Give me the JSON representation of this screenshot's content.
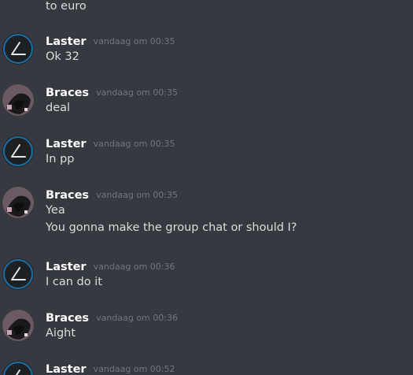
{
  "chat": {
    "continued_text": "to euro",
    "groups": [
      {
        "author": "Laster",
        "timestamp": "vandaag om 00:35",
        "avatar": "laster-logo-icon",
        "messages": [
          "Ok 32"
        ]
      },
      {
        "author": "Braces",
        "timestamp": "vandaag om 00:35",
        "avatar": "braces-avatar-image",
        "messages": [
          "deal"
        ]
      },
      {
        "author": "Laster",
        "timestamp": "vandaag om 00:35",
        "avatar": "laster-logo-icon",
        "messages": [
          "In pp"
        ]
      },
      {
        "author": "Braces",
        "timestamp": "vandaag om 00:35",
        "avatar": "braces-avatar-image",
        "messages": [
          "Yea",
          "You gonna make the group chat or should I?"
        ]
      },
      {
        "author": "Laster",
        "timestamp": "vandaag om 00:36",
        "avatar": "laster-logo-icon",
        "messages": [
          "I can do it"
        ]
      },
      {
        "author": "Braces",
        "timestamp": "vandaag om 00:36",
        "avatar": "braces-avatar-image",
        "messages": [
          "Aight"
        ]
      },
      {
        "author": "Laster",
        "timestamp": "vandaag om 00:52",
        "avatar": "laster-logo-icon",
        "messages": []
      }
    ]
  },
  "colors": {
    "background": "#36393f",
    "username": "#ffffff",
    "message_text": "#dcddde",
    "timestamp": "#72767d",
    "laster_avatar_bg": "#2f3136",
    "laster_avatar_ring": "#1e6fa8"
  }
}
